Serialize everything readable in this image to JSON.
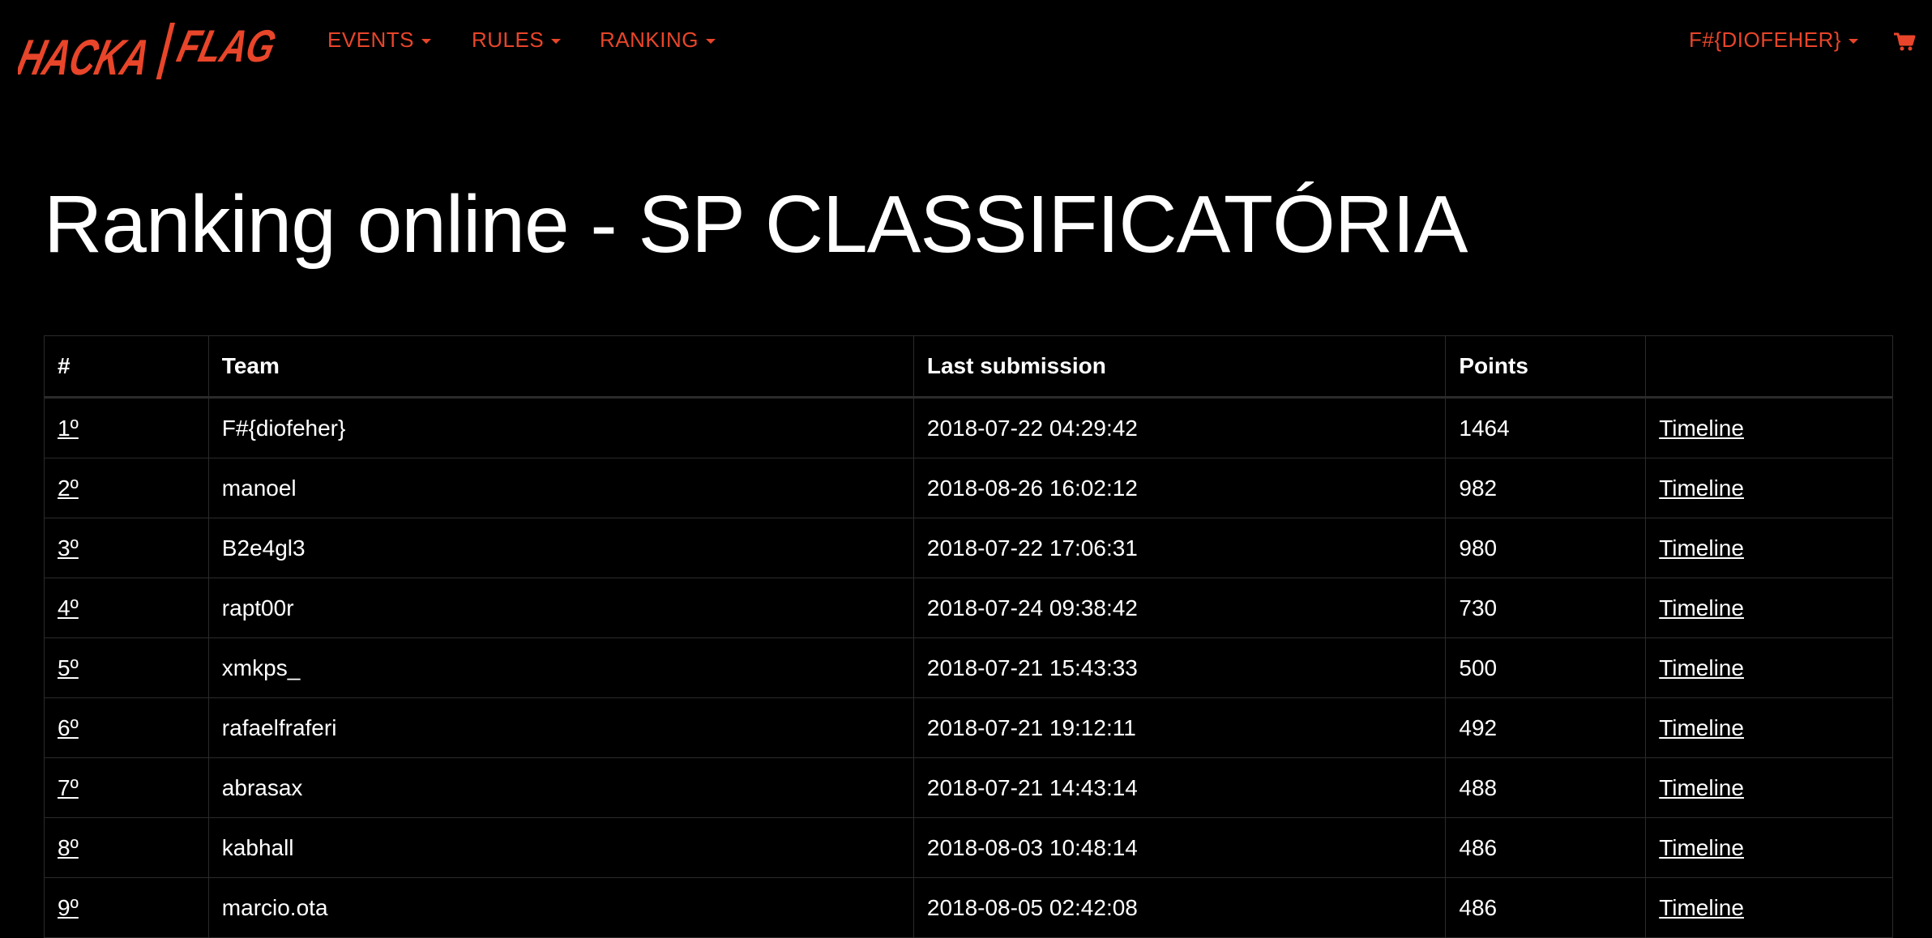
{
  "brand": {
    "logo_text": "HACKAFLAG",
    "accent_color": "#e8452a"
  },
  "nav": {
    "items": [
      {
        "label": "EVENTS"
      },
      {
        "label": "RULES"
      },
      {
        "label": "RANKING"
      }
    ],
    "user_label": "F#{DIOFEHER}",
    "cart_icon": "shopping-cart-icon"
  },
  "page": {
    "title": "Ranking online - SP CLASSIFICATÓRIA"
  },
  "table": {
    "headers": {
      "rank": "#",
      "team": "Team",
      "last_submission": "Last submission",
      "points": "Points",
      "action": ""
    },
    "rows": [
      {
        "rank": "1º",
        "team": "F#{diofeher}",
        "last_submission": "2018-07-22 04:29:42",
        "points": "1464",
        "action": "Timeline"
      },
      {
        "rank": "2º",
        "team": "manoel",
        "last_submission": "2018-08-26 16:02:12",
        "points": "982",
        "action": "Timeline"
      },
      {
        "rank": "3º",
        "team": "B2e4gl3",
        "last_submission": "2018-07-22 17:06:31",
        "points": "980",
        "action": "Timeline"
      },
      {
        "rank": "4º",
        "team": "rapt00r",
        "last_submission": "2018-07-24 09:38:42",
        "points": "730",
        "action": "Timeline"
      },
      {
        "rank": "5º",
        "team": "xmkps_",
        "last_submission": "2018-07-21 15:43:33",
        "points": "500",
        "action": "Timeline"
      },
      {
        "rank": "6º",
        "team": "rafaelfraferi",
        "last_submission": "2018-07-21 19:12:11",
        "points": "492",
        "action": "Timeline"
      },
      {
        "rank": "7º",
        "team": "abrasax",
        "last_submission": "2018-07-21 14:43:14",
        "points": "488",
        "action": "Timeline"
      },
      {
        "rank": "8º",
        "team": "kabhall",
        "last_submission": "2018-08-03 10:48:14",
        "points": "486",
        "action": "Timeline"
      },
      {
        "rank": "9º",
        "team": "marcio.ota",
        "last_submission": "2018-08-05 02:42:08",
        "points": "486",
        "action": "Timeline"
      }
    ]
  }
}
